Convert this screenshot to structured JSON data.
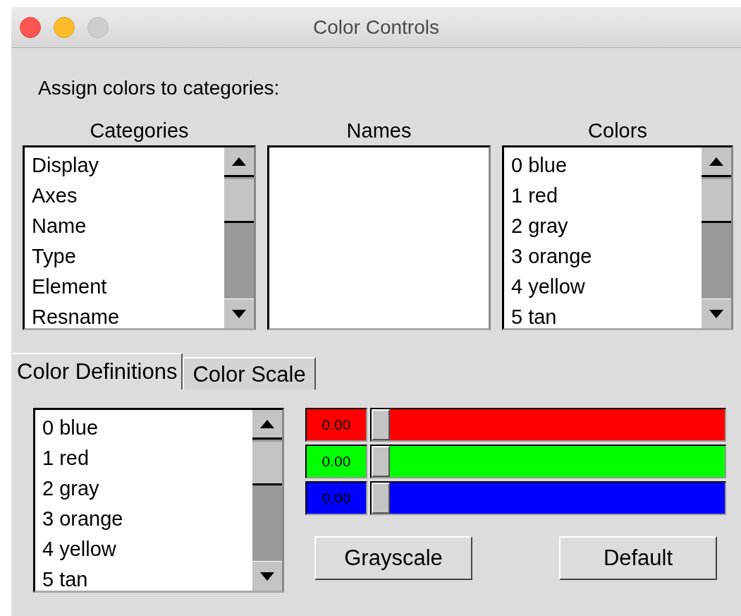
{
  "window": {
    "title": "Color Controls"
  },
  "instruction": "Assign colors to categories:",
  "lists": [
    {
      "header": "Categories",
      "items": [
        "Display",
        "Axes",
        "Name",
        "Type",
        "Element",
        "Resname"
      ]
    },
    {
      "header": "Names"
    },
    {
      "header": "Colors",
      "items": [
        "0 blue",
        "1 red",
        "2 gray",
        "3 orange",
        "4 yellow",
        "5 tan"
      ]
    }
  ],
  "tabs": [
    {
      "label": "Color Definitions",
      "selected": true
    },
    {
      "label": "Color Scale",
      "selected": false
    }
  ],
  "definitions_list": {
    "items": [
      "0 blue",
      "1 red",
      "2 gray",
      "3 orange",
      "4 yellow",
      "5 tan"
    ]
  },
  "sliders": [
    {
      "reading": "0.00",
      "color": "#ff0000",
      "level": 0
    },
    {
      "reading": "0.00",
      "color": "#00ff00",
      "level": 0
    },
    {
      "reading": "0.00",
      "color": "#0000ff",
      "level": 0
    }
  ],
  "buttons": [
    "Grayscale",
    "Default"
  ]
}
